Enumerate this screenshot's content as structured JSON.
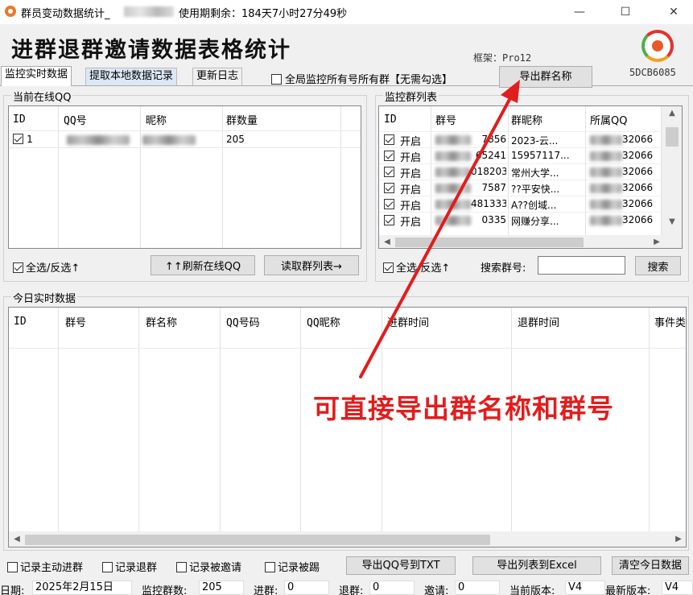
{
  "window": {
    "title_prefix": "群员变动数据统计_",
    "title_rest": "使用期剩余：184天7小时27分49秒",
    "minimize": "—",
    "maximize": "☐",
    "close": "✕"
  },
  "header": {
    "heading": "进群退群邀请数据表格统计",
    "framework": "框架：Pro12",
    "machine_code": "5DCB6085"
  },
  "tabs": [
    "监控实时数据",
    "提取本地数据记录",
    "更新日志"
  ],
  "global_monitor_label": "全局监控所有号所有群【无需勾选】",
  "export_group_names_button": "导出群名称",
  "online_qq": {
    "title": "当前在线QQ",
    "columns": [
      "ID",
      "QQ号",
      "昵称",
      "群数量"
    ],
    "rows": [
      {
        "id": "1",
        "group_count": "205",
        "checked": true
      }
    ],
    "select_all": "全选/反选↑",
    "refresh_button": "↑↑刷新在线QQ",
    "read_groups_button": "读取群列表→"
  },
  "monitor_groups": {
    "title": "监控群列表",
    "columns": [
      "ID",
      "群号",
      "群昵称",
      "所属QQ"
    ],
    "rows": [
      {
        "status": "开启",
        "group_no_tail": "7856",
        "name": "2023-云...",
        "owner_tail": "32066"
      },
      {
        "status": "开启",
        "group_no_tail": "65241",
        "name": "15957117...",
        "owner_tail": "32066"
      },
      {
        "status": "开启",
        "group_no_tail": "0182035",
        "name": "常州大学...",
        "owner_tail": "32066"
      },
      {
        "status": "开启",
        "group_no_tail": "7587",
        "name": "??平安快...",
        "owner_tail": "32066"
      },
      {
        "status": "开启",
        "group_no_tail": "481333",
        "name": "A??创域...",
        "owner_tail": "32066"
      },
      {
        "status": "开启",
        "group_no_tail": "0335",
        "name": "网赚分享...",
        "owner_tail": "32066"
      }
    ],
    "select_all": "全选/反选↑",
    "search_label": "搜索群号:",
    "search_value": "",
    "search_button": "搜索"
  },
  "today": {
    "title": "今日实时数据",
    "columns": [
      "ID",
      "群号",
      "群名称",
      "QQ号码",
      "QQ昵称",
      "进群时间",
      "退群时间",
      "事件类"
    ]
  },
  "annotation": "可直接导出群名称和群号",
  "options": [
    "记录主动进群",
    "记录退群",
    "记录被邀请",
    "记录被踢"
  ],
  "bottom_buttons": [
    "导出QQ号到TXT",
    "导出列表到Excel",
    "清空今日数据"
  ],
  "status": {
    "date_label": "日期:",
    "date_value": "2025年2月15日",
    "monitor_count_label": "监控群数:",
    "monitor_count_value": "205",
    "join_label": "进群:",
    "join_value": "0",
    "leave_label": "退群:",
    "leave_value": "0",
    "invite_label": "邀请:",
    "invite_value": "0",
    "current_version_label": "当前版本:",
    "current_version_value": "V4",
    "latest_version_label": "最新版本:",
    "latest_version_value": "V4"
  },
  "colors": {
    "annotation": "#e31c1c",
    "selected_tab": "#dce8f6"
  }
}
